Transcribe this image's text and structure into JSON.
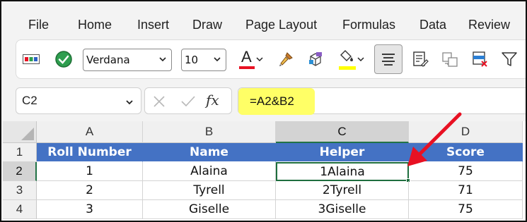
{
  "menu": {
    "items": [
      "File",
      "Home",
      "Insert",
      "Draw",
      "Page Layout",
      "Formulas",
      "Data",
      "Review"
    ]
  },
  "ribbon": {
    "font_name": "Verdana",
    "font_size": "10",
    "font_color_letter": "A",
    "font_color": "#e81123",
    "highlight_color": "#ffff00",
    "icons": [
      "cell-styles-icon",
      "check-circle-icon",
      "font-color-icon",
      "format-painter-icon",
      "3d-box-icon",
      "fill-color-icon",
      "align-center-icon",
      "form-icon",
      "move-icon",
      "delete-table-icon",
      "filter-icon"
    ]
  },
  "formula_bar": {
    "name_box": "C2",
    "fx_label": "fx",
    "formula": "=A2&B2"
  },
  "grid": {
    "columns": [
      "A",
      "B",
      "C",
      "D"
    ],
    "rows": [
      "1",
      "2",
      "3",
      "4"
    ],
    "selected_column": "C",
    "selected_row": "2",
    "header": [
      "Roll Number",
      "Name",
      "Helper",
      "Score"
    ],
    "data": [
      [
        "1",
        "Alaina",
        "1Alaina",
        "75"
      ],
      [
        "2",
        "Tyrell",
        "2Tyrell",
        "71"
      ],
      [
        "3",
        "Giselle",
        "3Giselle",
        "75"
      ]
    ]
  },
  "colors": {
    "header_fill": "#4472c4",
    "selection_green": "#1e6e3e",
    "formula_highlight": "#ffff66",
    "arrow": "#e81123"
  }
}
